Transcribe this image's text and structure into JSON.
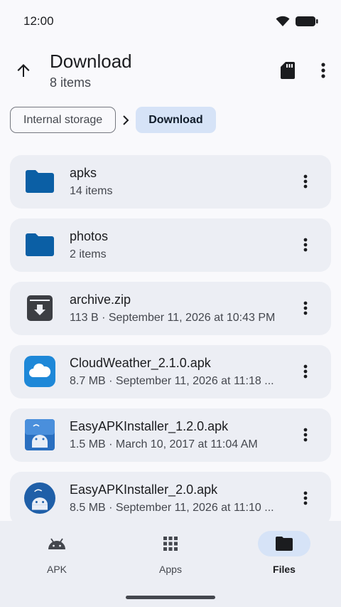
{
  "status": {
    "time": "12:00"
  },
  "header": {
    "title": "Download",
    "subtitle": "8 items"
  },
  "breadcrumbs": [
    "Internal storage",
    "Download"
  ],
  "files": [
    {
      "name": "apks",
      "meta": "14 items",
      "icon": "folder-icon"
    },
    {
      "name": "photos",
      "meta": "2 items",
      "icon": "folder-icon"
    },
    {
      "name": "archive.zip",
      "meta": "113 B · September 11, 2026 at 10:43 PM",
      "icon": "archive-icon"
    },
    {
      "name": "CloudWeather_2.1.0.apk",
      "meta": "8.7 MB · September 11, 2026 at 11:18 ...",
      "icon": "cloud-app-icon"
    },
    {
      "name": "EasyAPKInstaller_1.2.0.apk",
      "meta": "1.5 MB · March 10, 2017 at 11:04 AM",
      "icon": "easy-installer-icon"
    },
    {
      "name": "EasyAPKInstaller_2.0.apk",
      "meta": "8.5 MB · September 11, 2026 at 11:10 ...",
      "icon": "easy-installer-round-icon"
    }
  ],
  "nav": {
    "apk": "APK",
    "apps": "Apps",
    "files": "Files",
    "active": "Files"
  },
  "colors": {
    "accent": "#d6e3f7",
    "folder": "#0b5fa5",
    "surface": "#eceef4"
  }
}
